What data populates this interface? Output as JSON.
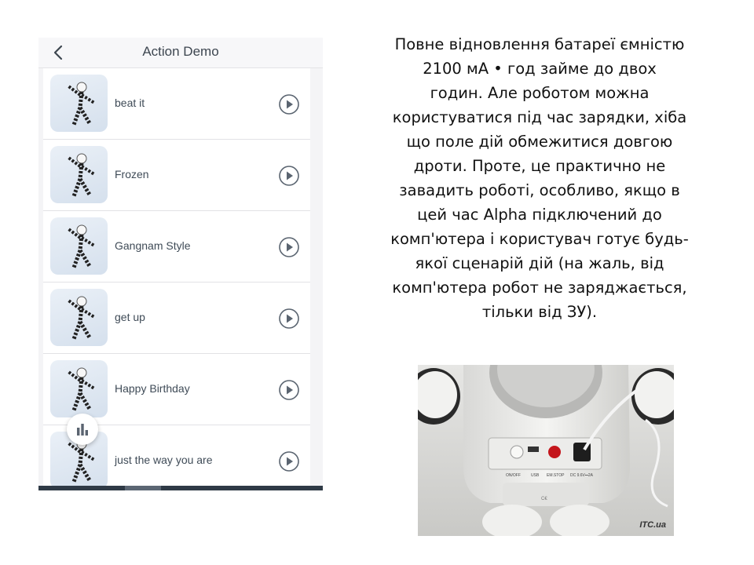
{
  "phone": {
    "header": {
      "title": "Action Demo",
      "back_icon": "chevron-left-icon"
    },
    "actions": [
      {
        "label": "beat it",
        "icon": "play-circle-icon"
      },
      {
        "label": "Frozen",
        "icon": "play-circle-icon"
      },
      {
        "label": "Gangnam Style",
        "icon": "play-circle-icon"
      },
      {
        "label": "get up",
        "icon": "play-circle-icon"
      },
      {
        "label": "Happy Birthday",
        "icon": "play-circle-icon"
      },
      {
        "label": "just the way you are",
        "icon": "play-circle-icon"
      }
    ],
    "fab_icon": "bar-chart-icon"
  },
  "description": {
    "lines": [
      "Повне відновлення батареї ємністю",
      "2100 мА • год займе до двох",
      "годин. Але роботом можна",
      "користуватися під час зарядки, хіба",
      "що поле дій обмежитися довгою",
      "дроти. Проте, це практично не",
      "завадить роботі, особливо, якщо в",
      "цей час Alpha підключений до",
      "комп'ютера і користувач готує будь-",
      "якої сценарій дій (на жаль, від",
      "комп'ютера робот не заряджається,",
      "тільки від ЗУ)."
    ]
  },
  "photo": {
    "panel_labels": [
      "ON/OFF",
      "USB",
      "EM.STOP",
      "DC 9.6V⎓2A"
    ],
    "watermark": "ITC.ua"
  },
  "colors": {
    "text_dark": "#3f4b57",
    "icon_gray": "#5a6470",
    "bottom_bar": "#2f3a46",
    "emergency_stop": "#c4161c"
  }
}
